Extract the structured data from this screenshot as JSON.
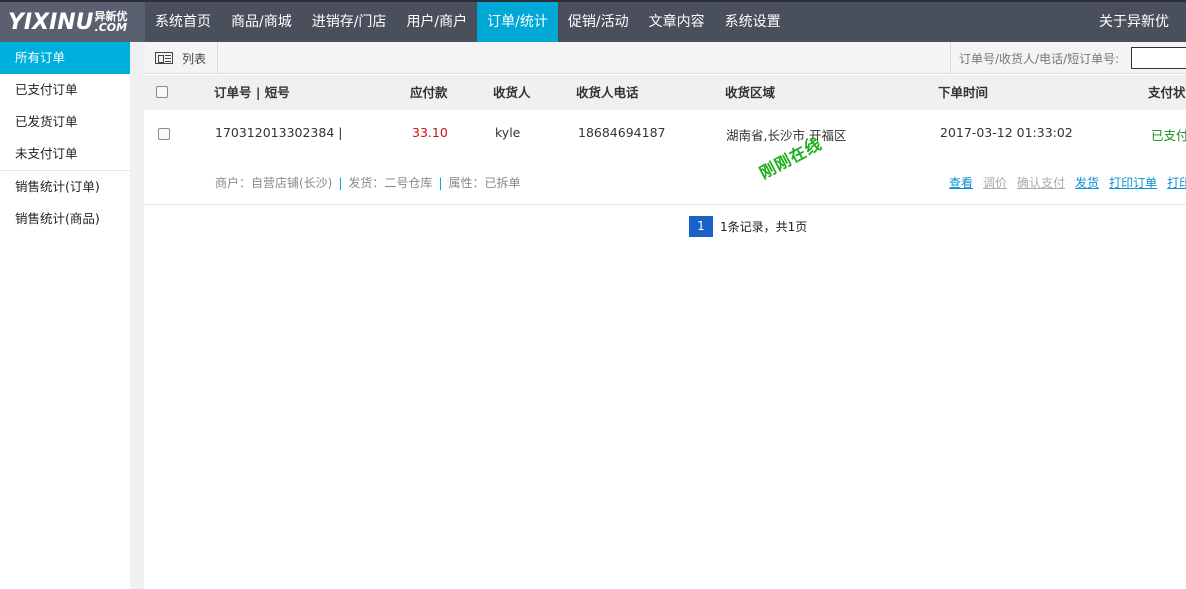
{
  "logo": {
    "main": "YIXINU",
    "cn": "异新优",
    "com": ".COM"
  },
  "nav": {
    "items": [
      {
        "label": "系统首页"
      },
      {
        "label": "商品/商城"
      },
      {
        "label": "进销存/门店"
      },
      {
        "label": "用户/商户"
      },
      {
        "label": "订单/统计",
        "active": true
      },
      {
        "label": "促销/活动"
      },
      {
        "label": "文章内容"
      },
      {
        "label": "系统设置"
      }
    ],
    "about": "关于异新优"
  },
  "sidebar": {
    "items": [
      {
        "label": "所有订单",
        "active": true
      },
      {
        "label": "已支付订单"
      },
      {
        "label": "已发货订单"
      },
      {
        "label": "未支付订单"
      },
      {
        "label": "销售统计(订单)"
      },
      {
        "label": "销售统计(商品)"
      }
    ]
  },
  "toolbar": {
    "view_label": "列表",
    "search_label": "订单号/收货人/电话/短订单号:",
    "search_value": ""
  },
  "table": {
    "headers": {
      "order_no": "订单号 | 短号",
      "amount": "应付款",
      "receiver": "收货人",
      "phone": "收货人电话",
      "region": "收货区域",
      "time": "下单时间",
      "pay_status": "支付状"
    },
    "rows": [
      {
        "order_no": "170312013302384 |",
        "amount": "33.10",
        "receiver": "kyle",
        "phone": "18684694187",
        "region": "湖南省,长沙市,开福区",
        "time": "2017-03-12 01:33:02",
        "pay_status": "已支付",
        "stamp": "刚刚在线",
        "merchant": "商户：自营店铺(长沙)",
        "ship": "发货：二号仓库",
        "attr": "属性：已拆单",
        "actions": {
          "view": "查看",
          "adjust": "调价",
          "confirm_pay": "确认支付",
          "ship": "发货",
          "print_order": "打印订单",
          "print_more": "打印"
        }
      }
    ]
  },
  "pager": {
    "current": "1",
    "info": "1条记录，共1页"
  },
  "colors": {
    "topbar": "#4a4f5c",
    "accent": "#00a8d6",
    "pager": "#1a62c9"
  }
}
